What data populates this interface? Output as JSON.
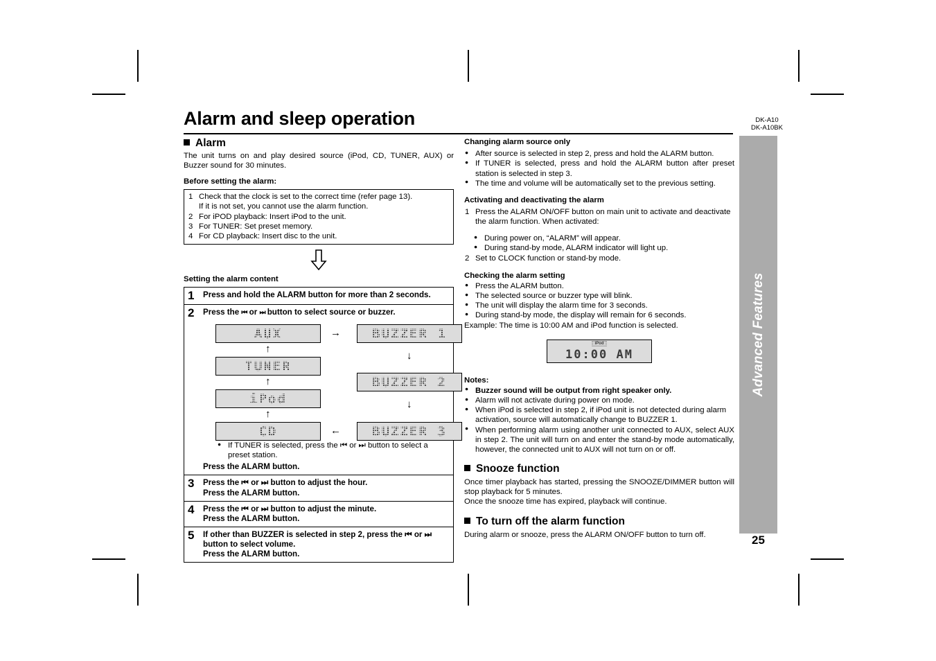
{
  "page": {
    "title": "Alarm and sleep operation",
    "model_line1": "DK-A10",
    "model_line2": "DK-A10BK",
    "sidebar_label": "Advanced Features",
    "page_number": "25"
  },
  "left": {
    "alarm_heading": "Alarm",
    "alarm_intro": "The unit turns on and play desired source (iPod, CD, TUNER, AUX) or Buzzer sound for 30 minutes.",
    "before_heading": "Before setting the alarm:",
    "before_items": [
      "Check that the clock is set to the correct time (refer page 13).",
      "For iPOD playback: Insert iPod to the unit.",
      "For TUNER: Set preset memory.",
      "For CD playback: Insert disc to the unit."
    ],
    "before_item1_cont": "If it is not set, you cannot use the alarm function.",
    "setting_heading": "Setting the alarm content",
    "steps": [
      {
        "num": "1",
        "text": "Press and hold the ALARM button for more than 2 seconds."
      },
      {
        "num": "2",
        "text_a": "Press the ",
        "btn_prev": "⏮",
        "text_b": " or ",
        "btn_next": "⏭",
        "text_c": " button to select source or buzzer.",
        "note": "If TUNER is selected, press the ⏮ or ⏭ button to select a preset station.",
        "confirm": "Press the ALARM button."
      },
      {
        "num": "3",
        "line1": "Press the ⏮ or ⏭ button to adjust the hour.",
        "line2": "Press the ALARM button."
      },
      {
        "num": "4",
        "line1": "Press the ⏮ or ⏭ button to adjust the minute.",
        "line2": "Press the ALARM button."
      },
      {
        "num": "5",
        "line1": "If other than BUZZER is selected in step 2, press the ⏮ or ⏭ button to select volume.",
        "line2": "Press the ALARM button."
      }
    ],
    "flow": {
      "sources": [
        "AUX",
        "TUNER",
        "iPod",
        "CD"
      ],
      "buzzers": [
        "BUZZER 1",
        "BUZZER 2",
        "BUZZER 3"
      ],
      "arrow_right": "→",
      "arrow_left": "←",
      "arrow_up": "↑",
      "arrow_down": "↓"
    }
  },
  "right": {
    "changing_heading": "Changing alarm source only",
    "changing_items": [
      "After source is selected in step 2, press and hold the ALARM button.",
      "If TUNER is selected, press and hold the ALARM button after preset station is selected in step 3.",
      "The time and volume will be automatically set to the previous setting."
    ],
    "activating_heading": "Activating and deactivating the alarm",
    "activating_item1": "Press the ALARM ON/OFF button on main unit to activate and deactivate the alarm function. When activated:",
    "activating_subitems": [
      "During power on, “ALARM” will appear.",
      "During stand-by mode, ALARM indicator will light up."
    ],
    "activating_item2": "Set to CLOCK function or stand-by mode.",
    "checking_heading": "Checking the alarm setting",
    "checking_items": [
      "Press the ALARM button.",
      "The selected source or buzzer type will blink.",
      "The unit will display the alarm time for 3 seconds.",
      "During stand-by mode, the display will remain for 6 seconds."
    ],
    "example_text": "Example: The time is 10:00 AM and iPod function is selected.",
    "example_display": {
      "indicator": "iPod",
      "time": "10:00 AM"
    },
    "notes_heading": "Notes:",
    "notes": [
      "Buzzer sound will be output from right speaker only.",
      "Alarm will not activate during power on mode.",
      "When iPod is selected in step 2, if iPod unit is not detected during alarm activation, source will automatically change to BUZZER 1.",
      "When performing alarm using another unit connected to AUX, select AUX in step 2. The unit will turn on and enter the stand-by mode automatically, however, the connected unit to AUX will not turn on or off."
    ],
    "snooze_heading": "Snooze function",
    "snooze_text1": "Once timer playback has started, pressing the SNOOZE/DIMMER button will stop playback for 5 minutes.",
    "snooze_text2": "Once the snooze time has expired, playback will continue.",
    "turnoff_heading": "To turn off the alarm function",
    "turnoff_text": "During alarm or snooze, press the ALARM ON/OFF button to turn off."
  }
}
